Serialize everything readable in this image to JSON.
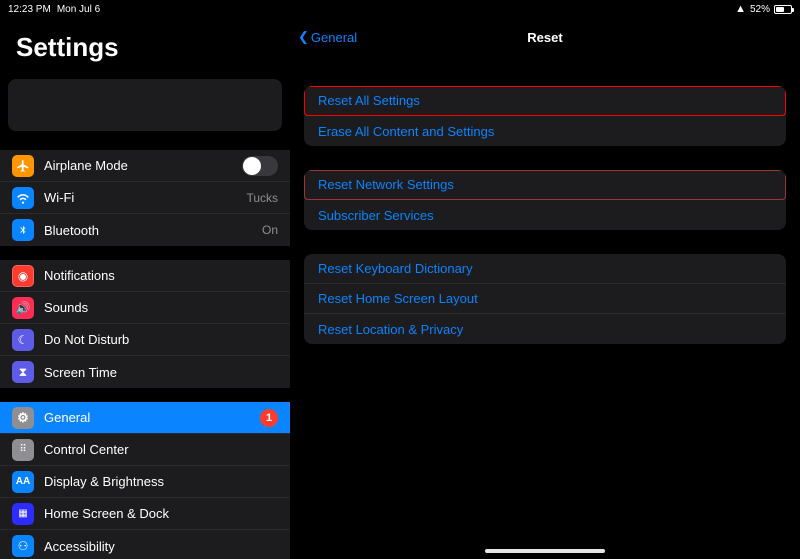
{
  "status": {
    "time": "12:23 PM",
    "date": "Mon Jul 6",
    "battery_percent": "52%"
  },
  "sidebar": {
    "title": "Settings",
    "airplane": {
      "label": "Airplane Mode"
    },
    "wifi": {
      "label": "Wi-Fi",
      "value": "Tucks"
    },
    "bluetooth": {
      "label": "Bluetooth",
      "value": "On"
    },
    "notifications": {
      "label": "Notifications"
    },
    "sounds": {
      "label": "Sounds"
    },
    "dnd": {
      "label": "Do Not Disturb"
    },
    "screen_time": {
      "label": "Screen Time"
    },
    "general": {
      "label": "General",
      "badge": "1"
    },
    "control_center": {
      "label": "Control Center"
    },
    "display": {
      "label": "Display & Brightness"
    },
    "home_screen": {
      "label": "Home Screen & Dock"
    },
    "accessibility": {
      "label": "Accessibility"
    }
  },
  "detail": {
    "back_label": "General",
    "title": "Reset",
    "group1": {
      "reset_all": "Reset All Settings",
      "erase_all": "Erase All Content and Settings"
    },
    "group2": {
      "reset_network": "Reset Network Settings",
      "subscriber": "Subscriber Services"
    },
    "group3": {
      "reset_keyboard": "Reset Keyboard Dictionary",
      "reset_home": "Reset Home Screen Layout",
      "reset_location": "Reset Location & Privacy"
    }
  }
}
